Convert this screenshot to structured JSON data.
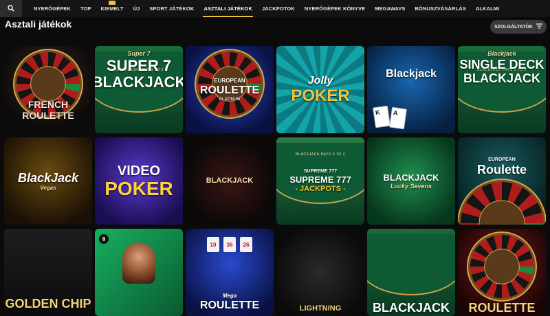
{
  "nav": {
    "items": [
      "NYERŐGÉPEK",
      "TOP",
      "KIEMELT",
      "ÚJ",
      "SPORT JÁTÉKOK",
      "ASZTALI JÁTÉKOK",
      "JACKPOTOK",
      "NYERŐGÉPEK KÖNYVE",
      "MEGAWAYS",
      "BÓNUSZVÁSÁRLÁS",
      "ALKALMI"
    ],
    "active": "ASZTALI JÁTÉKOK",
    "badge_on": "KIEMELT"
  },
  "section": {
    "title": "Asztali játékok",
    "provider_label": "SZOLGÁLTATÓK"
  },
  "games": [
    {
      "id": "french-roulette",
      "lines": [
        "FRENCH",
        "ROULETTE"
      ],
      "theme": "dark-roulette",
      "accent": "#c0392b"
    },
    {
      "id": "super-7-blackjack",
      "lines": [
        "Super 7",
        "SUPER 7",
        "BLACKJACK"
      ],
      "felt_text": "BLACKJACK PAYS 3 TO 2",
      "theme": "green-felt",
      "accent": "#0e5a34"
    },
    {
      "id": "european-roulette-platinum",
      "lines": [
        "EUROPEAN",
        "ROULETTE",
        "PLATINUM"
      ],
      "theme": "blue-roulette",
      "accent": "#1b2f8a"
    },
    {
      "id": "jolly-poker",
      "lines": [
        "Jolly",
        "POKER"
      ],
      "theme": "teal-rays",
      "accent": "#0f7f86"
    },
    {
      "id": "blackjack",
      "lines": [
        "Blackjack"
      ],
      "cards": [
        "K",
        "A"
      ],
      "theme": "blue-cards",
      "accent": "#0a3a6b"
    },
    {
      "id": "single-deck-blackjack",
      "lines": [
        "Blackjack",
        "SINGLE DECK",
        "BLACKJACK"
      ],
      "felt_text": "BLACKJACK PAYS 3 TO 2",
      "theme": "green-felt",
      "accent": "#0e5a34"
    },
    {
      "id": "blackjack-vegas",
      "lines": [
        "BlackJack",
        "Vegas"
      ],
      "theme": "gold-badge",
      "accent": "#d49a1f"
    },
    {
      "id": "video-poker",
      "lines": [
        "VIDEO",
        "POKER"
      ],
      "theme": "purple-cards",
      "accent": "#3a1f8c"
    },
    {
      "id": "blackjack-dark",
      "lines": [
        "BLACKJACK"
      ],
      "theme": "dark-ornament",
      "accent": "#8a1a1a"
    },
    {
      "id": "supreme-777-jackpots",
      "lines": [
        "SUPREME 777",
        "SUPREME 777",
        "- JACKPOTS -"
      ],
      "felt_text": "BLACKJACK PAYS 3 TO 2",
      "theme": "green-felt-gold",
      "accent": "#0e5a34"
    },
    {
      "id": "blackjack-lucky-sevens",
      "lines": [
        "BLACKJACK",
        "Lucky Sevens"
      ],
      "theme": "green-chips",
      "accent": "#0c5d33"
    },
    {
      "id": "european-roulette",
      "lines": [
        "EUROPEAN",
        "Roulette"
      ],
      "theme": "teal-wheel",
      "accent": "#0b3d3f"
    },
    {
      "id": "golden-chip",
      "lines": [
        "GOLDEN CHIP"
      ],
      "theme": "dark-gold",
      "accent": "#1a1a1a"
    },
    {
      "id": "live-dealer",
      "lines": [],
      "badge": "9",
      "theme": "green-dealer",
      "accent": "#0f8a4a"
    },
    {
      "id": "mega-roulette",
      "lines": [
        "Mega",
        "ROULETTE"
      ],
      "numbers": [
        "10",
        "36",
        "26"
      ],
      "theme": "blue-mega",
      "accent": "#142a7a"
    },
    {
      "id": "lightning",
      "lines": [
        "LIGHTNING"
      ],
      "theme": "dark-lightning",
      "accent": "#222"
    },
    {
      "id": "blackjack-bottom",
      "lines": [
        "BLACKJACK"
      ],
      "theme": "green-felt",
      "accent": "#0e5a34"
    },
    {
      "id": "roulette-bottom",
      "lines": [
        "ROULETTE"
      ],
      "theme": "red-roulette",
      "accent": "#5a1010"
    }
  ]
}
